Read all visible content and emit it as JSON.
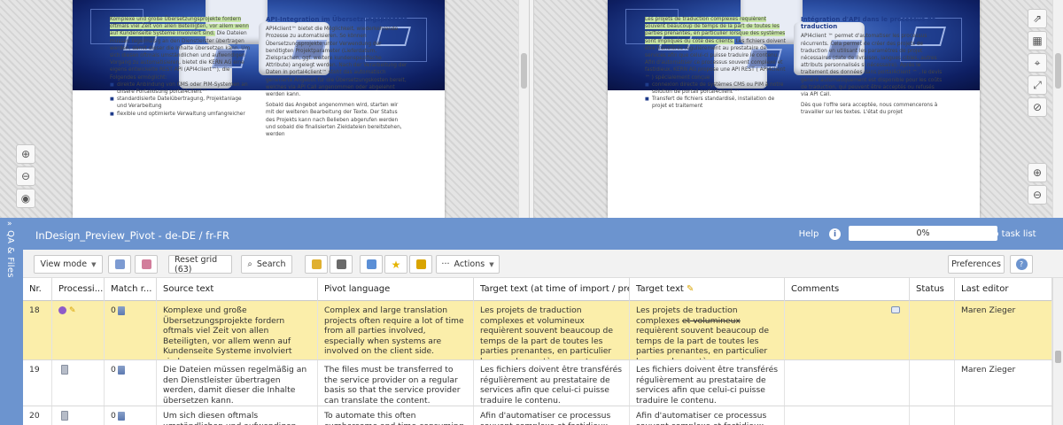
{
  "preview": {
    "left": {
      "col1": {
        "highlight": "Komplexe und große Übersetzungsprojekte fordern oftmals viel Zeit von allen Beteiligten, vor allem wenn auf Kundenseite Systeme involviert sind.",
        "rest": " Die Dateien müssen regelmäßig an den Dienstleister übertragen werden, damit dieser die Inhalte übersetzen kann. Um sich diesen oftmals umständlichen und aufwendigen Vorgang zu automatisieren, bietet die KERN AG eine eigens entwickelte REST API (API4client™), die Folgendes ermöglicht:",
        "bullets": [
          "direkte Anbindung von CMS oder PIM-Systemen an unsere Portallösung portal4client™",
          "standardisierte Dateiübertragung, Projektanlage und Verarbeitung",
          "flexible und optimierte Verwaltung umfangreicher"
        ]
      },
      "col2": {
        "heading": "API-Integration im Übersetzungsprozess",
        "p1": "API4client™ bietet die Möglichkeit, wiederkehrende Prozesse zu automatisieren. So können Übersetzungsprojekte unter Verwendung der benötigten Projektparameter (Lieferdatum, Zielsprachen, ggf. weitere kundenspezifische Attribute) angelegt werden. Nach der Verarbeitung der Daten in portal4client™ steht das automatisch generierte Angebot für die Übersetzungskosten bereit, welches via API Call angenommen oder abgelehnt werden kann.",
        "p2": "Sobald das Angebot angenommen wird, starten wir mit der weiteren Bearbeitung der Texte. Der Status des Projekts kann nach Belieben abgerufen werden und sobald die finalisierten Zieldateien bereitstehen, werden"
      }
    },
    "right": {
      "col1": {
        "highlight": "Les projets de traduction complexes requièrent souvent beaucoup de temps de la part de toutes les parties prenantes, en particulier lorsque des systèmes sont impliqués du côté des clients.",
        "rest": " Les fichiers doivent être transférés régulièrement au prestataire de services afin que celui-ci puisse traduire le contenu. Afin d'automatiser ce processus souvent complexe et fastidieux, KERN AG propose une API REST ( API4client ™ ) spécialement conçue :",
        "bullets": [
          "connexion directe de systèmes CMS ou PIM à notre solution de portail portal4client ™",
          "Transfert de fichiers standardisé, installation de projet et traitement"
        ]
      },
      "col2": {
        "heading": "Intégration d'API dans le processus de traduction",
        "p1": "API4client ™ permet d'automatiser les processus récurrents. Cela permet de créer des projets de traduction en utilisant les paramètres de projet nécessaires (date de livraison, langues cibles, autres attributs personnalisés si nécessaire). Après le traitement des données dans portal4client ™ , le devis généré automatiquement est disponible pour les coûts de traduction, qui peuvent être acceptés ou refusés via API Call.",
        "p2": "Dès que l'offre sera acceptée, nous commencerons à travailler sur les textes. L'état du projet"
      }
    }
  },
  "sidebar": {
    "label": "QA & Files"
  },
  "titlebar": {
    "title": "InDesign_Preview_Pivot - de-DE / fr-FR",
    "help": "Help",
    "info": "i",
    "progress": "0%",
    "back": "Back to task list"
  },
  "toolbar": {
    "view_mode": "View mode",
    "reset_grid": "Reset grid (63)",
    "search": "Search",
    "actions": "Actions",
    "preferences": "Preferences"
  },
  "grid": {
    "headers": [
      "Nr.",
      "Processi...",
      "Match r...",
      "Source text",
      "Pivot language",
      "Target text (at time of import / pretr...",
      "Target text",
      "Comments",
      "Status",
      "Last editor"
    ],
    "rows": [
      {
        "nr": "18",
        "match": "0",
        "source": "Komplexe und große Übersetzungsprojekte fordern oftmals viel Zeit von allen Beteiligten, vor allem wenn auf Kundenseite Systeme involviert sind.",
        "pivot": "Complex and large translation projects often require a lot of time from all parties involved, especially when systems are involved on the client side.",
        "target_import": "Les projets de traduction complexes et volumineux requièrent souvent beaucoup de temps de la part de toutes les parties prenantes, en particulier lorsque des systèmes sont impliqués du côté des clients.",
        "target_a": "Les projets de traduction complexes ",
        "target_strike": "et volumineux",
        "target_b": " requièrent souvent beaucoup de temps de la part de toutes les parties prenantes, en particulier lorsque des systèmes sont impliqués du côté des clients.",
        "editor": "Maren Zieger"
      },
      {
        "nr": "19",
        "match": "0",
        "source": "Die Dateien müssen regelmäßig an den Dienstleister übertragen werden, damit dieser die Inhalte übersetzen kann.",
        "pivot": "The files must be transferred to the service provider on a regular basis so that the service provider can translate the content.",
        "target_import": "Les fichiers doivent être transférés régulièrement au prestataire de services afin que celui-ci puisse traduire le contenu.",
        "target": "Les fichiers doivent être transférés régulièrement au prestataire de services afin que celui-ci puisse traduire le contenu.",
        "editor": "Maren Zieger"
      },
      {
        "nr": "20",
        "match": "0",
        "source": "Um sich diesen oftmals umständlichen und aufwendigen Vorgang zu",
        "pivot": "To automate this often cumbersome and time-consuming process, KERN AG offers",
        "target_import": "Afin d'automatiser ce processus souvent complexe et fastidieux, KERN AG propose",
        "target": "Afin d'automatiser ce processus souvent complexe et fastidieux, KERN AG propose",
        "editor": ""
      }
    ]
  },
  "colors": {
    "accent_blue": "#6c94cf",
    "selected_row": "#fbeeaa",
    "highlight_green": "#c8e6a6"
  }
}
